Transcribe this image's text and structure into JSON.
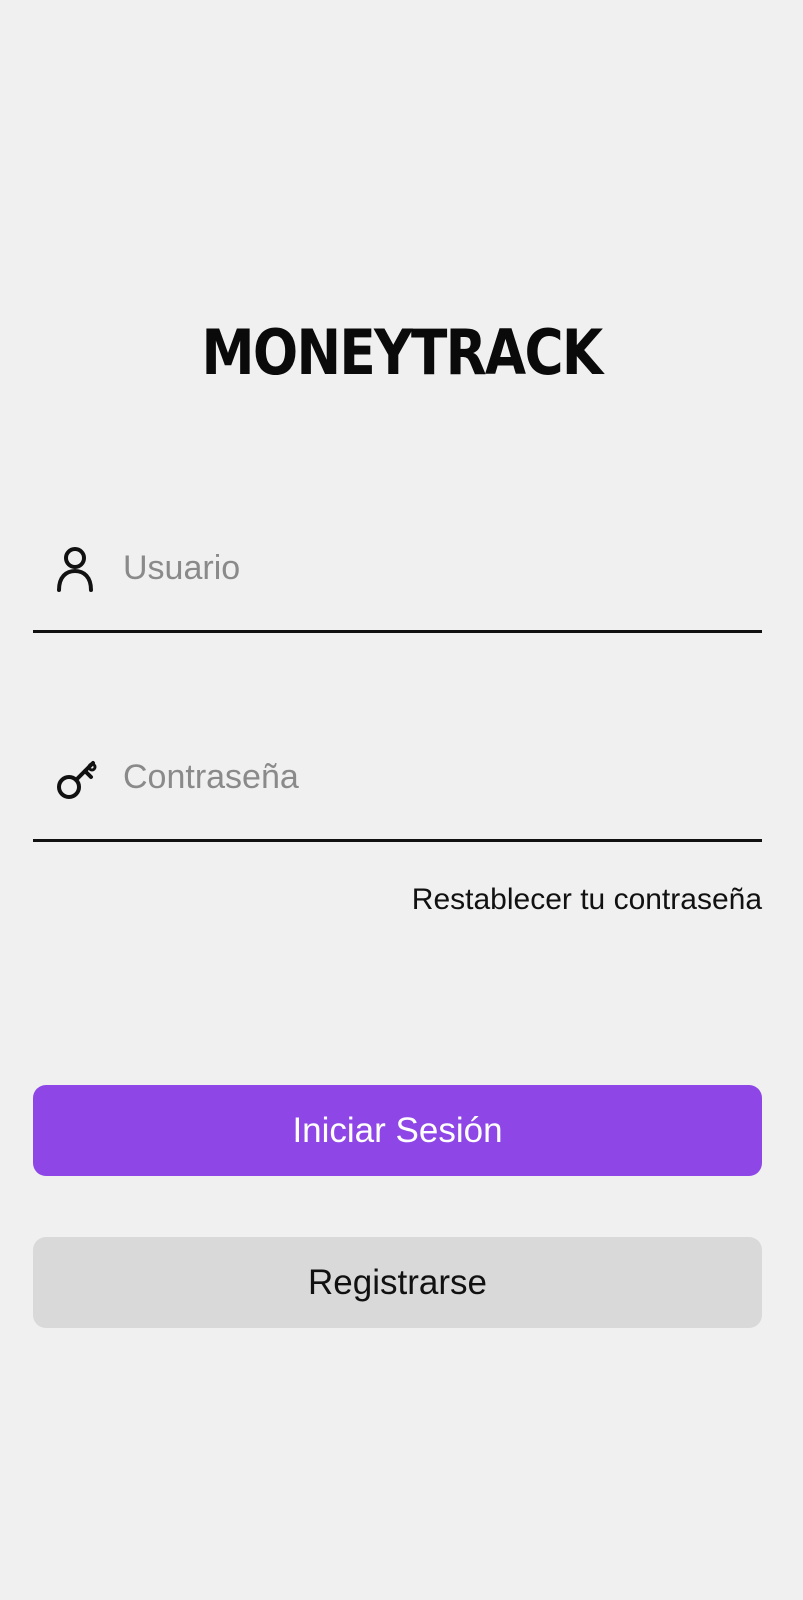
{
  "app": {
    "logo_text": "MONEYTRACK"
  },
  "login_form": {
    "username": {
      "icon": "user-icon",
      "placeholder": "Usuario",
      "value": ""
    },
    "password": {
      "icon": "key-icon",
      "placeholder": "Contraseña",
      "value": ""
    },
    "reset_password_label": "Restablecer tu contraseña",
    "login_button_label": "Iniciar Sesión",
    "register_button_label": "Registrarse"
  },
  "colors": {
    "background": "#f0f0f0",
    "primary": "#8e47e6",
    "secondary": "#d9d9d9",
    "text": "#111111",
    "placeholder": "#8a8a8a"
  }
}
